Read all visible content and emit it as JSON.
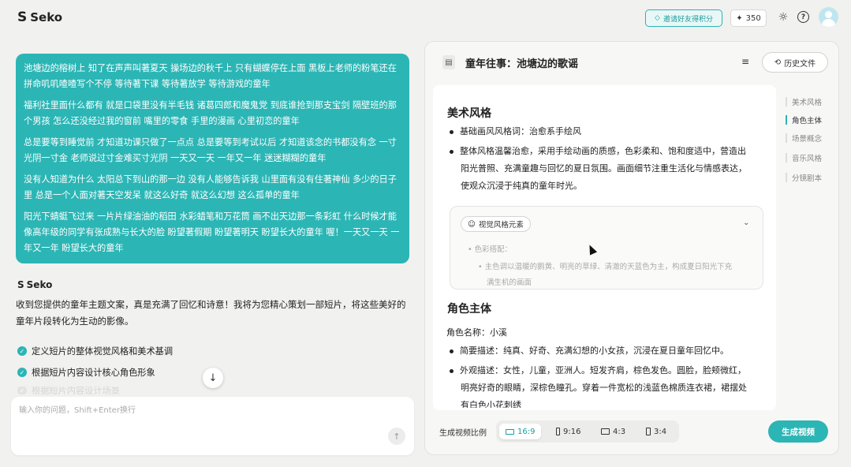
{
  "app": {
    "name": "Seko"
  },
  "topbar": {
    "invite_label": "邀请好友得积分",
    "credits": "350"
  },
  "chat": {
    "user_message": [
      "池塘边的榕树上 知了在声声叫著夏天 操场边的秋千上 只有蝴蝶停在上面 黑板上老师的粉笔还在拼命叽叽喳喳写个不停 等待著下课 等待著放学 等待游戏的童年",
      "福利社里面什么都有 就是口袋里没有半毛钱 诸葛四郎和魔鬼党 到底谁抢到那支宝剑 隔壁班的那个男孩 怎么还没经过我的窗前 嘴里的零食 手里的漫画 心里初恋的童年",
      "总是要等到睡觉前 才知道功课只做了一点点 总是要等到考试以后 才知道该念的书都没有念 一寸光阴一寸金 老师说过寸金难买寸光阴 一天又一天 一年又一年 迷迷糊糊的童年",
      "没有人知道为什么 太阳总下到山的那一边 没有人能够告诉我 山里面有没有住著神仙 多少的日子里 总是一个人面对著天空发呆 就这么好奇 就这么幻想 这么孤单的童年",
      "阳光下蜻蜓飞过来 一片片绿油油的稻田 水彩蜡笔和万花筒 画不出天边那一条彩虹 什么时候才能像高年级的同学有张成熟与长大的脸 盼望著假期 盼望著明天 盼望长大的童年 喔！一天又一天 一年又一年 盼望长大的童年"
    ],
    "bot_name": "Seko",
    "bot_reply": "收到您提供的童年主题文案，真是充满了回忆和诗意！我将为您精心策划一部短片，将这些美好的童年片段转化为生动的影像。",
    "todos": [
      {
        "label": "定义短片的整体视觉风格和美术基调"
      },
      {
        "label": "根据短片内容设计核心角色形象"
      },
      {
        "label": "根据短片内容设计场景"
      }
    ],
    "input_placeholder": "输入你的问题，Shift+Enter换行"
  },
  "panel": {
    "title": "童年往事：池塘边的歌谣",
    "history_label": "历史文件",
    "sections": {
      "art": {
        "heading": "美术风格",
        "b1": "基础画风风格词：治愈系手绘风",
        "b2_line1": "整体风格温馨治愈，采用手绘动画的质感，色彩柔和、饱和度适中，营造出",
        "b2_line2": "阳光普照、充满童趣与回忆的夏日氛围。画面细节注重生活化与情感表达，",
        "b2_line3": "使观众沉浸于纯真的童年时光。"
      },
      "visual": {
        "tag": "视觉风格元素",
        "line1": "色彩搭配：",
        "line2": "主色调以温暖的鹅黄、明亮的草绿、清澈的天蓝色为主，构成夏日阳光下充",
        "line3": "满生机的画面"
      },
      "character": {
        "heading": "角色主体",
        "name_line": "角色名称：小溪",
        "b1": "简要描述：纯真、好奇、充满幻想的小女孩，沉浸在夏日童年回忆中。",
        "b2_line1": "外观描述：女性，儿童，亚洲人。短发齐肩，棕色发色。圆脸，脸颊微红，",
        "b2_line2": "明亮好奇的眼睛，深棕色瞳孔。穿着一件宽松的浅蓝色棉质连衣裙，裙摆处",
        "b2_line3": "有白色小花刺绣"
      }
    },
    "toc": [
      "美术风格",
      "角色主体",
      "场景概念",
      "音乐风格",
      "分镜剧本"
    ],
    "toc_active_index": 1,
    "ratio_label": "生成视频比例",
    "ratios": [
      "16:9",
      "9:16",
      "4:3",
      "3:4"
    ],
    "ratio_selected": "16:9",
    "generate_label": "生成视频"
  },
  "colors": {
    "accent": "#2cb5b5",
    "panel_bg": "#f7f7f6",
    "page_bg": "#f1f1ef"
  },
  "icons": [
    "seko-logo-icon",
    "diamond-icon",
    "sparkle-icon",
    "sun-icon",
    "help-icon",
    "avatar",
    "check-icon",
    "arrow-down-icon",
    "send-icon",
    "document-icon",
    "outline-icon",
    "history-icon",
    "palette-icon",
    "chevron-down-icon",
    "cursor"
  ]
}
